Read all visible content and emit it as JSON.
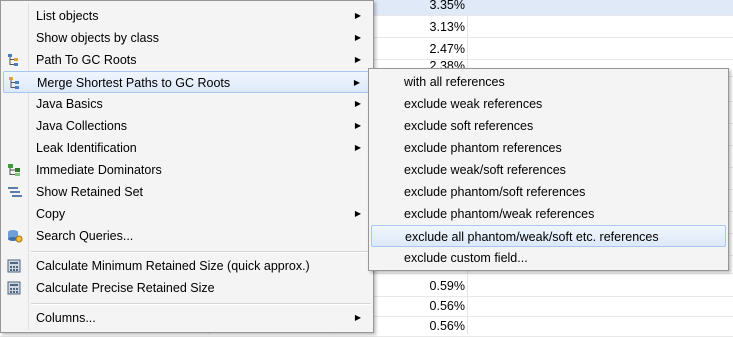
{
  "background_table": {
    "rows": [
      {
        "percent": "3.35%",
        "selected": true
      },
      {
        "percent": "3.13%"
      },
      {
        "percent": "2.47%"
      },
      {
        "percent": "2.38%"
      },
      {
        "percent": "0.59%"
      },
      {
        "percent": "0.56%"
      },
      {
        "percent": "0.56%"
      }
    ]
  },
  "menu": {
    "items": [
      {
        "label": "List objects",
        "icon": "none",
        "arrow": "▶"
      },
      {
        "label": "Show objects by class",
        "icon": "none",
        "arrow": "▶"
      },
      {
        "label": "Path To GC Roots",
        "icon": "gc-path-icon",
        "arrow": "▶"
      },
      {
        "label": "Merge Shortest Paths to GC Roots",
        "icon": "merge-paths-icon",
        "arrow": "▶"
      },
      {
        "label": "Java Basics",
        "icon": "none",
        "arrow": "▶"
      },
      {
        "label": "Java Collections",
        "icon": "none",
        "arrow": "▶"
      },
      {
        "label": "Leak Identification",
        "icon": "none",
        "arrow": "▶"
      },
      {
        "label": "Immediate Dominators",
        "icon": "dominators-icon",
        "arrow": ""
      },
      {
        "label": "Show Retained Set",
        "icon": "retained-set-icon",
        "arrow": ""
      },
      {
        "label": "Copy",
        "icon": "none",
        "arrow": "▶"
      },
      {
        "label": "Search Queries...",
        "icon": "search-queries-icon",
        "arrow": ""
      },
      {
        "label": "Calculate Minimum Retained Size (quick approx.)",
        "icon": "calculator-icon",
        "arrow": ""
      },
      {
        "label": "Calculate Precise Retained Size",
        "icon": "calculator-icon",
        "arrow": ""
      },
      {
        "label": "Columns...",
        "icon": "none",
        "arrow": "▶"
      }
    ]
  },
  "submenu": {
    "items": [
      {
        "label": "with all references"
      },
      {
        "label": "exclude weak references"
      },
      {
        "label": "exclude soft references"
      },
      {
        "label": "exclude phantom references"
      },
      {
        "label": "exclude weak/soft references"
      },
      {
        "label": "exclude phantom/soft references"
      },
      {
        "label": "exclude phantom/weak references"
      },
      {
        "label": "exclude all phantom/weak/soft etc. references"
      },
      {
        "label": "exclude custom field..."
      }
    ]
  },
  "colors": {
    "highlight_border": "#a9c6ee",
    "menu_background": "#f4f4f4",
    "selected_row": "#dfe9f7"
  }
}
